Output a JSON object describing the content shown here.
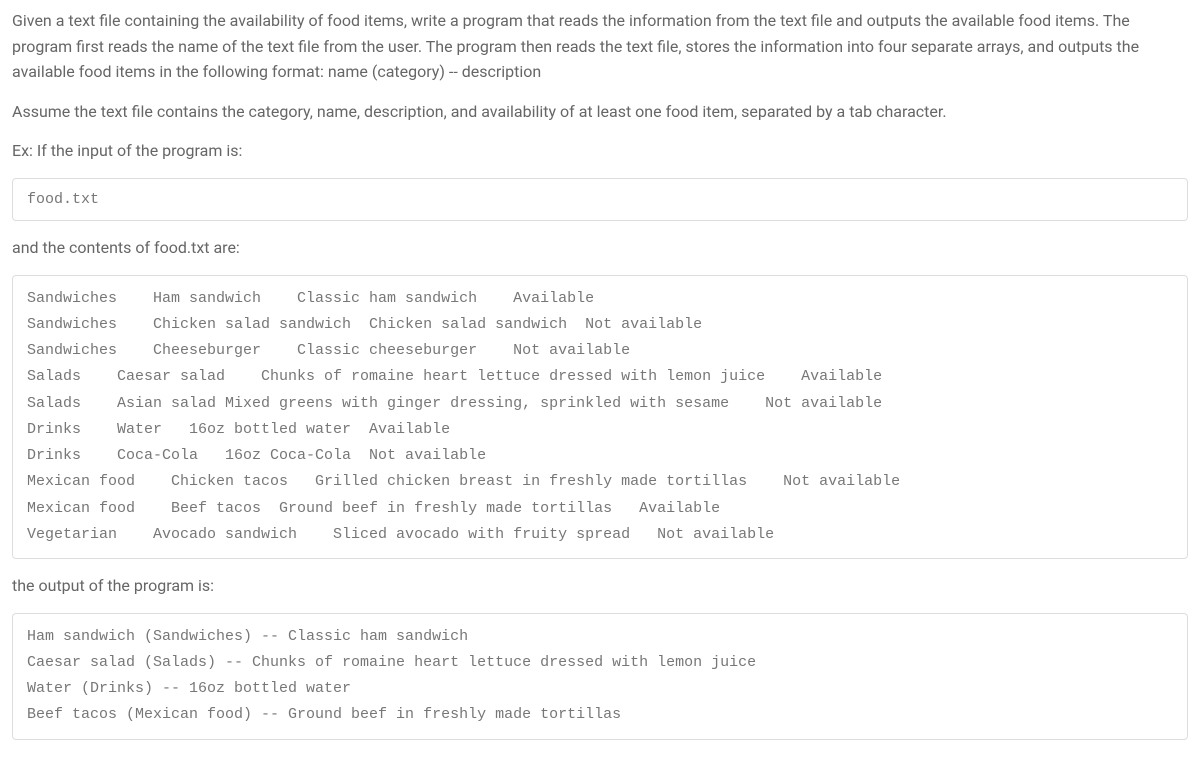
{
  "paragraphs": {
    "intro": "Given a text file containing the availability of food items, write a program that reads the information from the text file and outputs the available food items. The program first reads the name of the text file from the user. The program then reads the text file, stores the information into four separate arrays, and outputs the available food items in the following format: name (category) -- description",
    "assume": "Assume the text file contains the category, name, description, and availability of at least one food item, separated by a tab character.",
    "example_input_label": "Ex: If the input of the program is:",
    "contents_label": "and the contents of food.txt are:",
    "output_label": "the output of the program is:"
  },
  "code_blocks": {
    "input_filename": "food.txt",
    "file_contents": "Sandwiches    Ham sandwich    Classic ham sandwich    Available\nSandwiches    Chicken salad sandwich  Chicken salad sandwich  Not available\nSandwiches    Cheeseburger    Classic cheeseburger    Not available\nSalads    Caesar salad    Chunks of romaine heart lettuce dressed with lemon juice    Available\nSalads    Asian salad Mixed greens with ginger dressing, sprinkled with sesame    Not available\nDrinks    Water   16oz bottled water  Available\nDrinks    Coca-Cola   16oz Coca-Cola  Not available\nMexican food    Chicken tacos   Grilled chicken breast in freshly made tortillas    Not available\nMexican food    Beef tacos  Ground beef in freshly made tortillas   Available\nVegetarian    Avocado sandwich    Sliced avocado with fruity spread   Not available",
    "program_output": "Ham sandwich (Sandwiches) -- Classic ham sandwich\nCaesar salad (Salads) -- Chunks of romaine heart lettuce dressed with lemon juice\nWater (Drinks) -- 16oz bottled water\nBeef tacos (Mexican food) -- Ground beef in freshly made tortillas"
  }
}
